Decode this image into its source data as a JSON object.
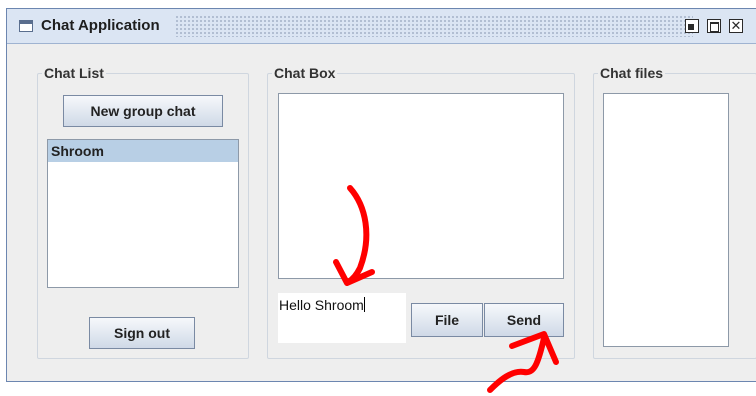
{
  "window": {
    "title": "Chat Application",
    "controls": [
      "iconify",
      "maximize",
      "close"
    ],
    "close_glyph": "✕"
  },
  "chat_list": {
    "legend": "Chat List",
    "new_group_label": "New group chat",
    "items": [
      {
        "label": "Shroom",
        "selected": true
      }
    ],
    "sign_out_label": "Sign out"
  },
  "chat_box": {
    "legend": "Chat Box",
    "message_value": "Hello Shroom",
    "file_label": "File",
    "send_label": "Send"
  },
  "chat_files": {
    "legend": "Chat files"
  },
  "annotations": {
    "color": "#ff0000",
    "arrows": 2
  }
}
